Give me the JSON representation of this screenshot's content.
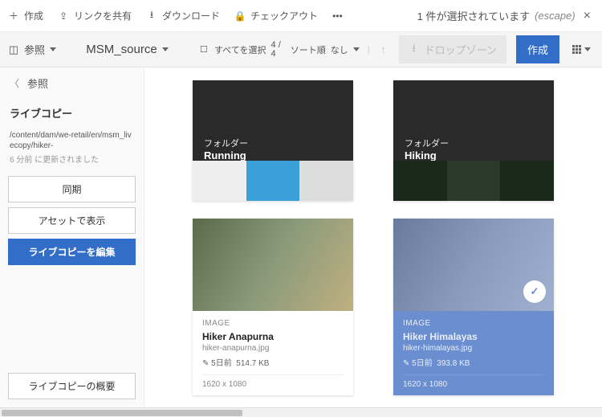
{
  "topbar": {
    "create": "作成",
    "share": "リンクを共有",
    "download": "ダウンロード",
    "checkout": "チェックアウト",
    "more": "•••",
    "selection": "1 件が選択されています",
    "escape": "(escape)",
    "close": "×"
  },
  "toolbar": {
    "rail": "参照",
    "breadcrumb": "MSM_source",
    "selectall": "すべてを選択",
    "count_sel": "4 /",
    "count_total": "4",
    "sort_label": "ソート順",
    "sort_value": "なし",
    "dropzone": "ドロップゾーン",
    "create_btn": "作成"
  },
  "rail": {
    "back": "〈",
    "heading": "参照",
    "section": "ライブコピー",
    "path": "/content/dam/we-retail/en/msm_livecopy/hiker-",
    "updated": "6 分前 に更新されました",
    "sync": "同期",
    "show_asset": "アセットで表示",
    "edit_lc": "ライブコピーを編集",
    "overview": "ライブコピーの概要"
  },
  "folders": [
    {
      "label": "フォルダー",
      "name": "Running"
    },
    {
      "label": "フォルダー",
      "name": "Hiking"
    }
  ],
  "assets": [
    {
      "type": "IMAGE",
      "title": "Hiker Anapurna",
      "file": "hiker-anapurna.jpg",
      "mod": "5日前",
      "size": "514.7 KB",
      "dim": "1620 x 1080",
      "selected": false
    },
    {
      "type": "IMAGE",
      "title": "Hiker Himalayas",
      "file": "hiker-himalayas.jpg",
      "mod": "5日前",
      "size": "393.8 KB",
      "dim": "1620 x 1080",
      "selected": true
    }
  ]
}
